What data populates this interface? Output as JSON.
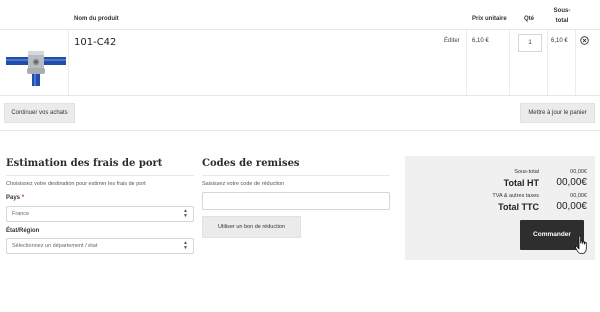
{
  "cart": {
    "headers": {
      "product": "Nom du produit",
      "unit_price": "Prix unitaire",
      "quantity": "Qté",
      "subtotal_line1": "Sous-",
      "subtotal_line2": "total"
    },
    "item": {
      "name": "101-C42",
      "edit_label": "Éditer",
      "unit_price": "6,10 €",
      "quantity": "1",
      "line_total": "6,10 €"
    },
    "continue_button": "Continuer vos achats",
    "update_button": "Mettre à jour le panier"
  },
  "shipping": {
    "title": "Estimation des frais de port",
    "description": "Choisissez votre destination pour estimer les frais de port",
    "country_label": "Pays",
    "required_mark": "*",
    "country_value": "France",
    "region_label": "État/Région",
    "region_placeholder": "Sélectionnez un département / état"
  },
  "coupon": {
    "title": "Codes de remises",
    "description": "Saisissez votre code de réduction",
    "input_value": "",
    "apply_button": "Utiliser un bon de réduction"
  },
  "totals": {
    "subtotal_label": "Sous-total",
    "subtotal_value": "00,00€",
    "total_ht_label": "Total HT",
    "total_ht_value": "00,00€",
    "tax_label": "TVA & autres taxes",
    "tax_value": "00,00€",
    "total_ttc_label": "Total TTC",
    "total_ttc_value": "00,00€",
    "checkout_button": "Commander"
  },
  "colors": {
    "checkout_bg": "#2e2e2e",
    "totals_bg": "#f0f0f0",
    "product_blue": "#1f4fa8"
  }
}
